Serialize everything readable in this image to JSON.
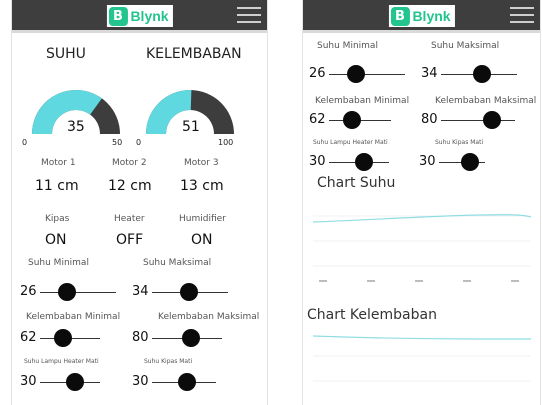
{
  "app": {
    "logo_letter": "B",
    "logo_text": "Blynk"
  },
  "left": {
    "suhu_title": "SUHU",
    "kelembaban_title": "KELEMBABAN",
    "gauge_suhu": {
      "value": "35",
      "min": "0",
      "max": "50",
      "fraction": 0.7
    },
    "gauge_kelembaban": {
      "value": "51",
      "min": "0",
      "max": "100",
      "fraction": 0.51
    },
    "motors": [
      {
        "label": "Motor 1",
        "value": "11 cm"
      },
      {
        "label": "Motor 2",
        "value": "12 cm"
      },
      {
        "label": "Motor 3",
        "value": "13 cm"
      }
    ],
    "status": [
      {
        "label": "Kipas",
        "value": "ON"
      },
      {
        "label": "Heater",
        "value": "OFF"
      },
      {
        "label": "Humidifier",
        "value": "ON"
      }
    ],
    "sliders": [
      {
        "label": "Suhu Minimal",
        "value": "26"
      },
      {
        "label": "Suhu Maksimal",
        "value": "34"
      },
      {
        "label": "Kelembaban Minimal",
        "value": "62"
      },
      {
        "label": "Kelembaban Maksimal",
        "value": "80"
      },
      {
        "label": "Suhu Lampu Heater Mati",
        "value": "30"
      },
      {
        "label": "Suhu Kipas Mati",
        "value": "30"
      }
    ]
  },
  "right": {
    "sliders": [
      {
        "label": "Suhu Minimal",
        "value": "26"
      },
      {
        "label": "Suhu Maksimal",
        "value": "34"
      },
      {
        "label": "Kelembaban Minimal",
        "value": "62"
      },
      {
        "label": "Kelembaban Maksimal",
        "value": "80"
      },
      {
        "label": "Suhu Lampu Heater Mati",
        "value": "30"
      },
      {
        "label": "Suhu Kipas Mati",
        "value": "30"
      }
    ],
    "chart_suhu_title": "Chart Suhu",
    "chart_kelembaban_title": "Chart Kelembaban"
  },
  "colors": {
    "gauge_fill": "#5fd8e0",
    "gauge_track": "#3d3d3d",
    "chart_line": "#8fdde3",
    "brand": "#23c48e",
    "topbar": "#3e3e3e"
  }
}
